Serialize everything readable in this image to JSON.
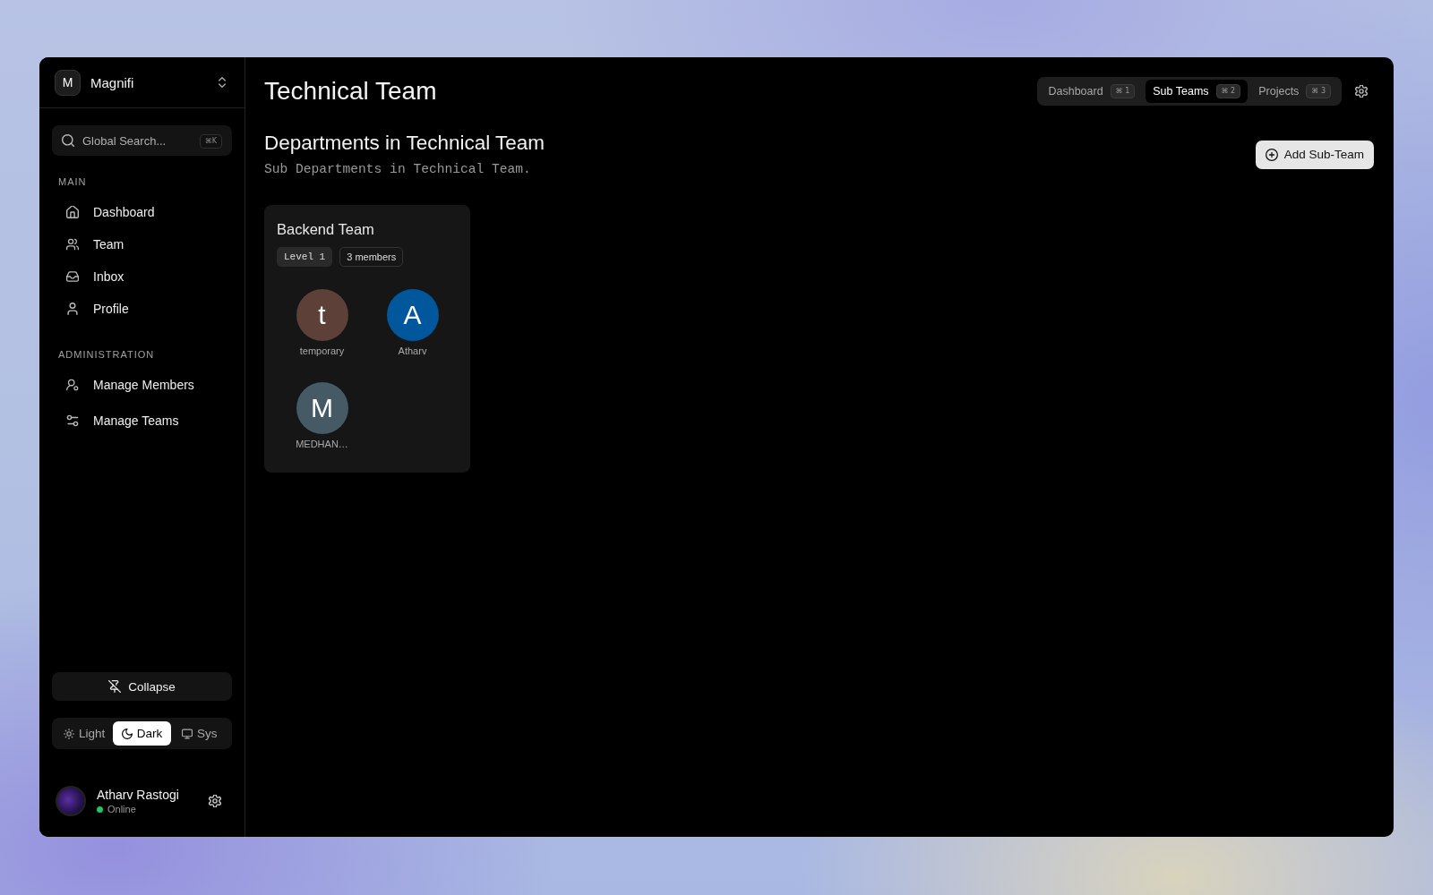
{
  "sidebar": {
    "workspace": {
      "initial": "M",
      "name": "Magnifi"
    },
    "search": {
      "placeholder": "Global Search...",
      "shortcut": "⌘K"
    },
    "sections": [
      {
        "heading": "MAIN",
        "items": [
          {
            "label": "Dashboard",
            "selected": false
          },
          {
            "label": "Team",
            "selected": false
          },
          {
            "label": "Inbox",
            "selected": false
          },
          {
            "label": "Profile",
            "selected": false
          }
        ]
      },
      {
        "heading": "ADMINISTRATION",
        "items": [
          {
            "label": "Manage Members",
            "selected": false
          },
          {
            "label": "Manage Teams",
            "selected": false
          }
        ]
      }
    ],
    "collapse_button": "Collapse",
    "theme_options": [
      {
        "label": "Light",
        "selected": false
      },
      {
        "label": "Dark",
        "selected": true
      },
      {
        "label": "Sys",
        "selected": false
      }
    ],
    "user": {
      "name": "Atharv Rastogi",
      "status": "Online",
      "online": true
    }
  },
  "header": {
    "title": "Technical Team",
    "tabs": [
      {
        "label": "Dashboard",
        "shortcut": "⌘ 1",
        "selected": false
      },
      {
        "label": "Sub Teams",
        "shortcut": "⌘ 2",
        "selected": true
      },
      {
        "label": "Projects",
        "shortcut": "⌘ 3",
        "selected": false
      }
    ]
  },
  "section": {
    "title": "Departments in Technical Team",
    "subtitle": "Sub Departments in Technical Team.",
    "add_button": "Add Sub-Team"
  },
  "teams": [
    {
      "name": "Backend Team",
      "level": "Level 1",
      "member_count": "3 members",
      "members": [
        {
          "initial": "t",
          "name": "temporary",
          "color": "#5d4037"
        },
        {
          "initial": "A",
          "name": "Atharv",
          "color": "#01579b"
        },
        {
          "initial": "M",
          "name": "MEDHAN…",
          "color": "#455a64"
        }
      ]
    }
  ]
}
